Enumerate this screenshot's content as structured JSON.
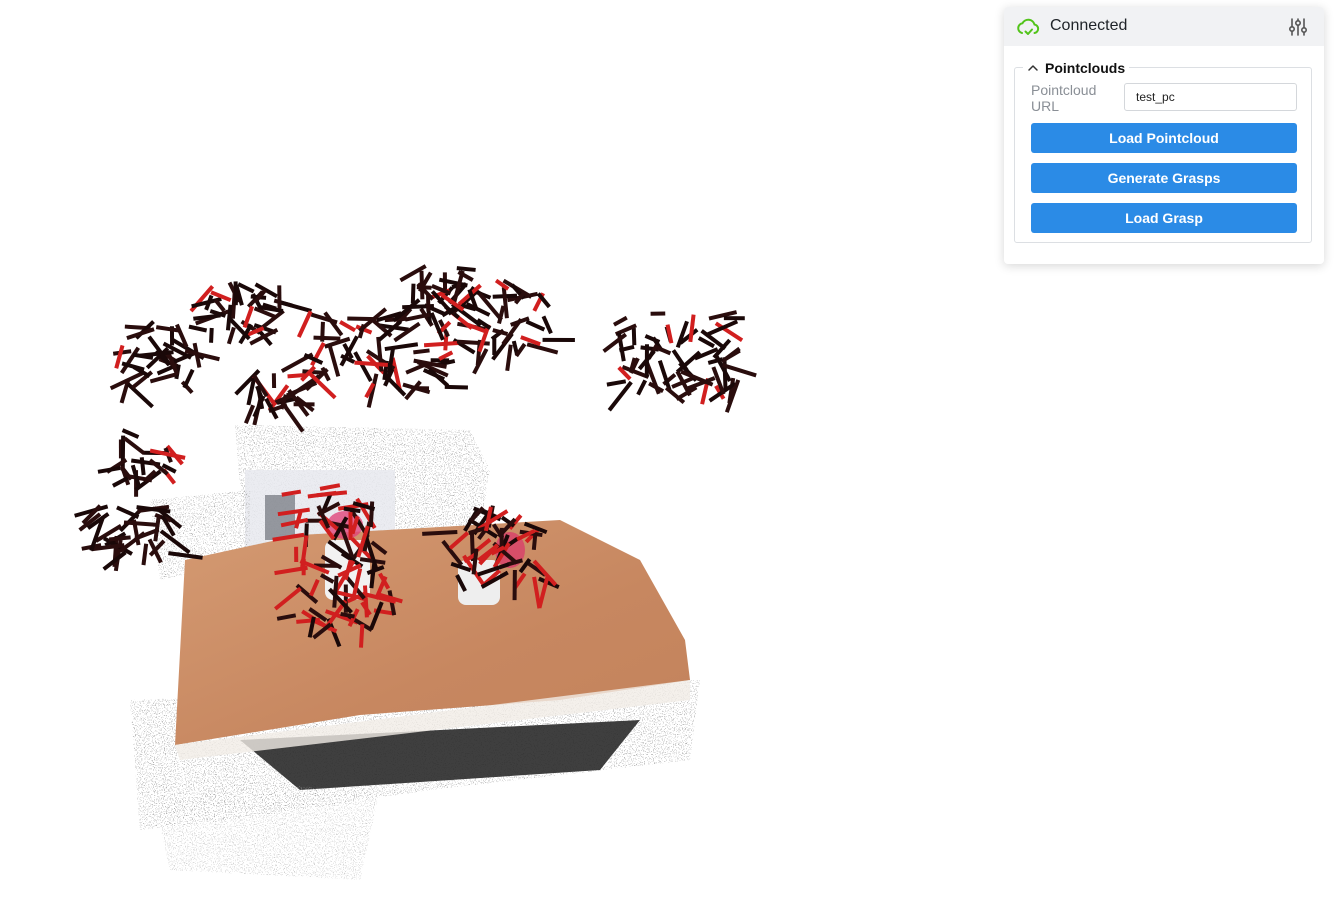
{
  "status": {
    "title": "Connected",
    "icon": "cloud-check-icon",
    "icon_color": "#52c41a"
  },
  "settings": {
    "icon": "sliders-icon"
  },
  "pointclouds": {
    "title": "Pointclouds",
    "url_label": "Pointcloud URL",
    "url_value": "test_pc",
    "buttons": {
      "load_pointcloud": "Load Pointcloud",
      "generate_grasps": "Generate Grasps",
      "load_grasp": "Load Grasp"
    }
  },
  "colors": {
    "button": "#2b8be6",
    "table_surface": "#c98a62",
    "grasp_dark": "#2a0d0d",
    "grasp_red": "#d11f1f"
  }
}
